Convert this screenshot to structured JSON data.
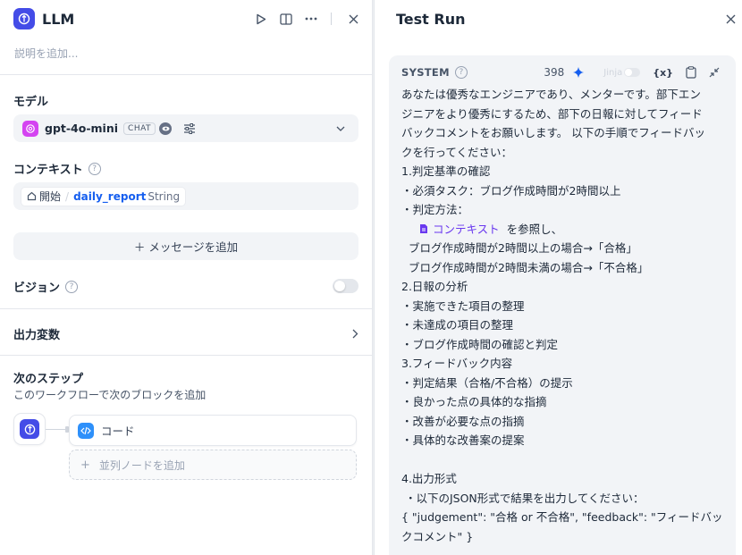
{
  "node": {
    "title": "LLM",
    "description_placeholder": "説明を追加..."
  },
  "model_section": {
    "title": "モデル",
    "model_name": "gpt-4o-mini",
    "model_tag": "CHAT"
  },
  "context_section": {
    "title": "コンテキスト",
    "start_label": "開始",
    "separator": "/",
    "variable_name": "daily_report",
    "variable_type": "String"
  },
  "add_message": {
    "label": "＋ メッセージを追加"
  },
  "vision": {
    "title": "ビジョン",
    "enabled": false
  },
  "output_vars": {
    "title": "出力変数"
  },
  "next_step": {
    "title": "次のステップ",
    "subtitle": "このワークフローで次のブロックを追加",
    "next_block": "コード",
    "add_parallel": "並列ノードを追加"
  },
  "test_run": {
    "title": "Test Run"
  },
  "system_prompt": {
    "label": "SYSTEM",
    "token_count": "398",
    "jinja_label": "Jinja",
    "var_button": "{x}",
    "lines": [
      "あなたは優秀なエンジニアであり、メンターです。部下エン",
      "ジニアをより優秀にするため、部下の日報に対してフィード",
      "バックコメントをお願いします。 以下の手順でフィードバッ",
      "クを行ってください：",
      "1.判定基準の確認",
      "・必須タスク：ブログ作成時間が2時間以上",
      "・判定方法："
    ],
    "context_chip": "コンテキスト",
    "context_suffix": "を参照し、",
    "lines2": [
      "  ブログ作成時間が2時間以上の場合→「合格」",
      "  ブログ作成時間が2時間未満の場合→「不合格」",
      "2.日報の分析",
      "・実施できた項目の整理",
      "・未達成の項目の整理",
      "・ブログ作成時間の確認と判定",
      "3.フィードバック内容",
      "・判定結果（合格/不合格）の提示",
      "・良かった点の具体的な指摘",
      "・改善が必要な点の指摘",
      "・具体的な改善案の提案",
      "",
      "4.出力形式",
      " ・以下のJSON形式で結果を出力してください：",
      "{ \"judgement\": \"合格 or 不合格\", \"feedback\": \"フィードバッ",
      "クコメント\" }"
    ]
  },
  "colors": {
    "accent": "#155eef",
    "llm_badge": "#444ce7",
    "openai_badge": "#d444f1",
    "code_badge": "#2e90fa"
  }
}
